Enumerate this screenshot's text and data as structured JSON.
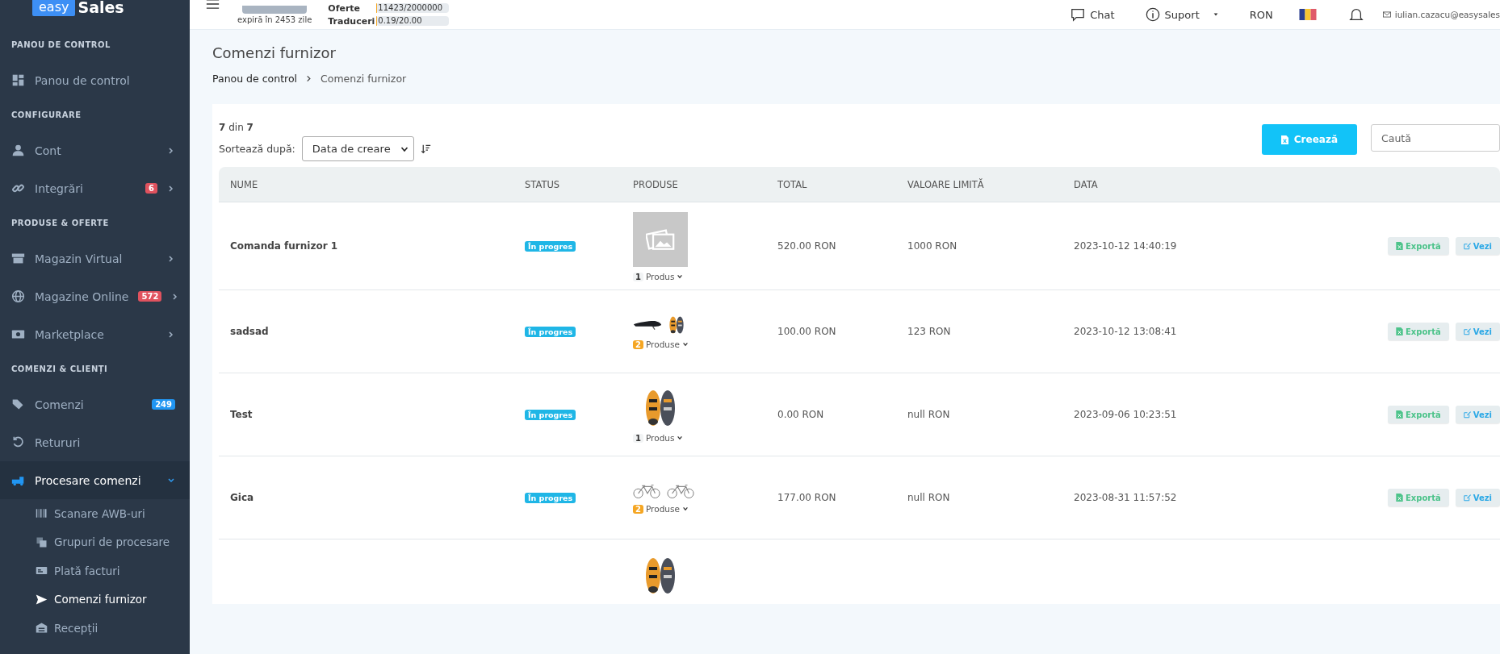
{
  "brand": {
    "light": "easy",
    "bold": "Sales"
  },
  "topbar": {
    "plan_note": "expiră în 2453 zile",
    "quotas": [
      {
        "label": "Oferte",
        "value": "11423/2000000",
        "level": 0.01
      },
      {
        "label": "Traduceri",
        "value": "0.19/20.00",
        "level": 0.01
      }
    ],
    "links": [
      {
        "kind": "chat",
        "label": "Chat",
        "dropdown": false
      },
      {
        "kind": "help",
        "label": "Suport",
        "dropdown": true
      }
    ],
    "currency": "RON",
    "user_email": "iulian.cazacu@easysales"
  },
  "sidebar": {
    "sections": [
      {
        "title": "PANOU DE CONTROL",
        "items": [
          {
            "kind": "grid",
            "label": "Panou de control",
            "expandable": false,
            "expanded": false
          }
        ]
      },
      {
        "title": "CONFIGURARE",
        "items": [
          {
            "kind": "user",
            "label": "Cont",
            "expandable": true,
            "expanded": false
          },
          {
            "kind": "link",
            "label": "Integrări",
            "badge": {
              "text": "6",
              "color": "#e0525e"
            },
            "expandable": true,
            "expanded": false
          }
        ]
      },
      {
        "title": "PRODUSE & OFERTE",
        "items": [
          {
            "kind": "store",
            "label": "Magazin Virtual",
            "expandable": true,
            "expanded": false
          },
          {
            "kind": "globe",
            "label": "Magazine Online",
            "badge": {
              "text": "572",
              "color": "#e0525e"
            },
            "expandable": true,
            "expanded": false
          },
          {
            "kind": "banknote",
            "label": "Marketplace",
            "expandable": true,
            "expanded": false
          }
        ]
      },
      {
        "title": "COMENZI & CLIENȚI",
        "items": [
          {
            "kind": "tag",
            "label": "Comenzi",
            "badge": {
              "text": "249",
              "color": "#2196f3"
            },
            "expandable": false,
            "expanded": false
          },
          {
            "kind": "undo",
            "label": "Retururi",
            "expandable": false,
            "expanded": false
          },
          {
            "kind": "truck",
            "label": "Procesare comenzi",
            "expandable": true,
            "expanded": true,
            "children": [
              {
                "kind": "barcode",
                "label": "Scanare AWB-uri",
                "selected": false
              },
              {
                "kind": "copy",
                "label": "Grupuri de procesare",
                "selected": false
              },
              {
                "kind": "card",
                "label": "Plată facturi",
                "selected": false
              },
              {
                "kind": "send",
                "label": "Comenzi furnizor",
                "selected": true
              },
              {
                "kind": "warehouse",
                "label": "Recepții",
                "selected": false
              }
            ]
          }
        ]
      }
    ]
  },
  "page": {
    "title": "Comenzi furnizor",
    "breadcrumb": [
      "Panou de control",
      "Comenzi furnizor"
    ],
    "count": "**7** din **7**",
    "sort_label": "Sortează după:",
    "sort_value": "Data de creare",
    "create_button": "Creează",
    "search": {
      "placeholder": "Caută"
    },
    "columns": [
      "NUME",
      "STATUS",
      "PRODUSE",
      "TOTAL",
      "VALOARE LIMITĂ",
      "DATA"
    ],
    "rows": [
      {
        "name": "Comanda furnizor 1",
        "status": "În progres",
        "products": [
          {
            "kind": "placeholder"
          }
        ],
        "product_count": "1",
        "color": "#f1f3f4",
        "product_label": "Produs",
        "total": "520.00 RON",
        "limit": "1000 RON",
        "date": "2023-10-12 14:40:19",
        "actions": [
          {
            "kind": "export",
            "label": "Exportă"
          },
          {
            "kind": "view",
            "label": "Vezi"
          }
        ]
      },
      {
        "name": "sadsad",
        "status": "În progres",
        "products": [
          {
            "kind": "saddle"
          },
          {
            "kind": "shoe"
          }
        ],
        "product_count": "2",
        "color": "#f5a623",
        "product_label": "Produse",
        "total": "100.00 RON",
        "limit": "123 RON",
        "date": "2023-10-12 13:08:41",
        "actions": [
          {
            "kind": "export",
            "label": "Exportă"
          },
          {
            "kind": "view",
            "label": "Vezi"
          }
        ]
      },
      {
        "name": "Test",
        "status": "În progres",
        "products": [
          {
            "kind": "shoe-large"
          }
        ],
        "product_count": "1",
        "color": "#f1f3f4",
        "product_label": "Produs",
        "total": "0.00 RON",
        "limit": "null RON",
        "date": "2023-09-06 10:23:51",
        "actions": [
          {
            "kind": "export",
            "label": "Exportă"
          },
          {
            "kind": "view",
            "label": "Vezi"
          }
        ]
      },
      {
        "name": "Gica",
        "status": "În progres",
        "products": [
          {
            "kind": "bike"
          },
          {
            "kind": "bike"
          }
        ],
        "product_count": "2",
        "color": "#f5a623",
        "product_label": "Produse",
        "total": "177.00 RON",
        "limit": "null RON",
        "date": "2023-08-31 11:57:52",
        "actions": [
          {
            "kind": "export",
            "label": "Exportă"
          },
          {
            "kind": "view",
            "label": "Vezi"
          }
        ]
      },
      {
        "products": [
          {
            "kind": "shoe-large"
          }
        ]
      }
    ]
  }
}
